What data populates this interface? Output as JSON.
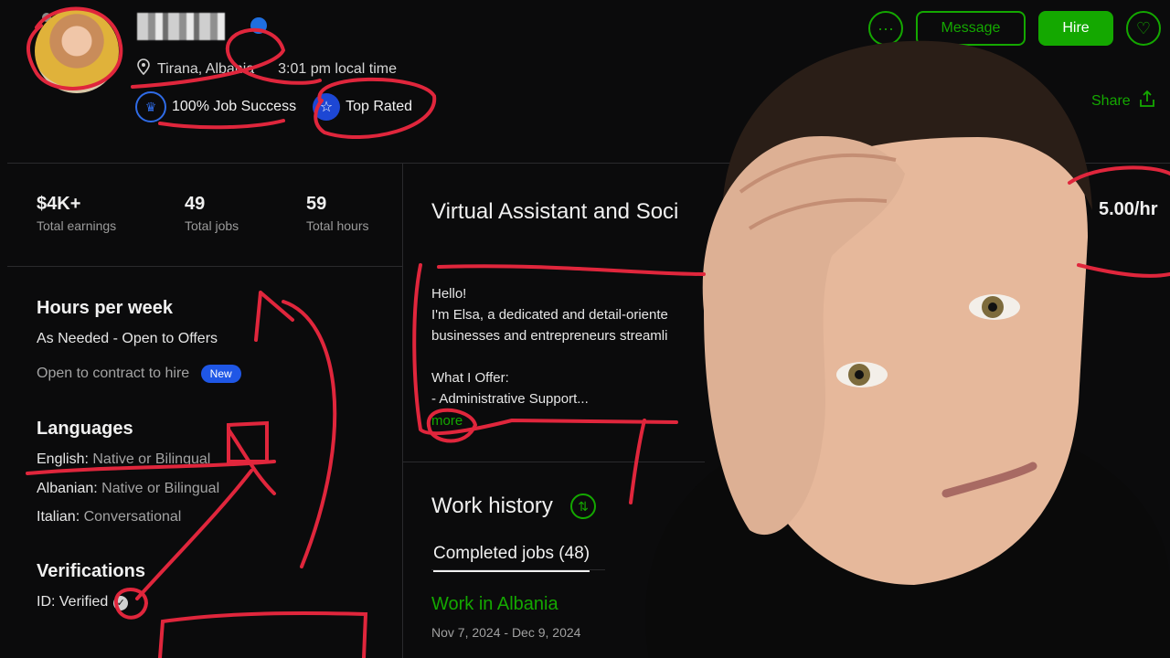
{
  "header": {
    "location": "Tirana, Albania",
    "local_time": "3:01 pm local time",
    "job_success": "100% Job Success",
    "top_rated": "Top Rated",
    "actions": {
      "more": "···",
      "message": "Message",
      "hire": "Hire",
      "share": "Share"
    }
  },
  "stats": [
    {
      "value": "$4K+",
      "label": "Total earnings"
    },
    {
      "value": "49",
      "label": "Total jobs"
    },
    {
      "value": "59",
      "label": "Total hours"
    }
  ],
  "hours": {
    "title": "Hours per week",
    "value": "As Needed - Open to Offers",
    "contract": "Open to contract to hire",
    "badge": "New"
  },
  "languages": {
    "title": "Languages",
    "items": [
      {
        "name": "English:",
        "level": "Native or Bilingual"
      },
      {
        "name": "Albanian:",
        "level": "Native or Bilingual"
      },
      {
        "name": "Italian:",
        "level": "Conversational"
      }
    ]
  },
  "verifications": {
    "title": "Verifications",
    "id": "ID: Verified"
  },
  "profile": {
    "title": "Virtual Assistant and Soci",
    "rate": "5.00/hr",
    "lines": [
      "Hello!",
      "I'm Elsa, a dedicated and detail-oriente",
      "businesses and entrepreneurs streamli",
      "",
      "What I Offer:",
      "- Administrative Support..."
    ],
    "more": "more"
  },
  "work_history": {
    "title": "Work history",
    "tab": "Completed jobs (48)",
    "job_title": "Work in Albania",
    "job_dates": "Nov 7, 2024 - Dec 9, 2024"
  },
  "colors": {
    "accent": "#14a800",
    "annotation": "#e0263c",
    "badge_blue": "#1f57e6"
  }
}
